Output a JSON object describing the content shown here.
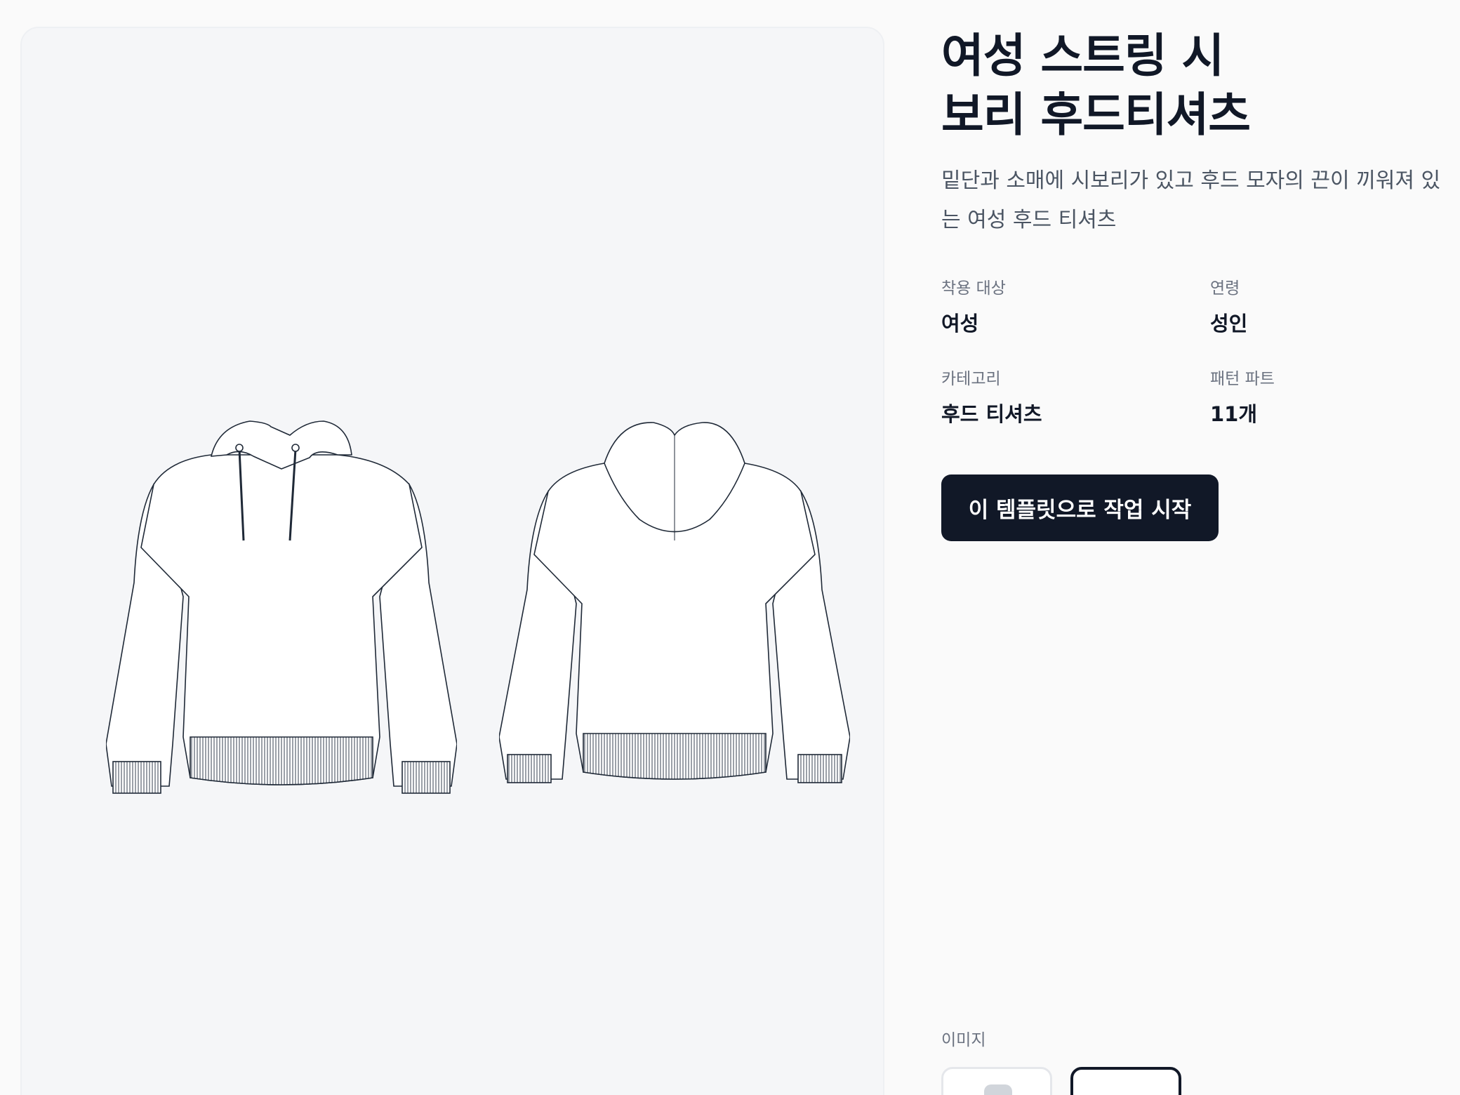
{
  "product": {
    "title_line1": "여성 스트링 시",
    "title_line2": "보리 후드티셔츠",
    "description_line1": "밑단과 소매에 시보리가 있고 후드 모자의 끈이 끼워져 있",
    "description_line2": "는 여성 후드 티셔츠"
  },
  "attributes": [
    {
      "label": "착용 대상",
      "value": "여성"
    },
    {
      "label": "연령",
      "value": "성인"
    },
    {
      "label": "카테고리",
      "value": "후드 티셔츠"
    },
    {
      "label": "패턴 파트",
      "value": "11개"
    }
  ],
  "actions": {
    "start_label": "이 템플릿으로 작업 시작"
  },
  "gallery": {
    "label": "이미지"
  }
}
